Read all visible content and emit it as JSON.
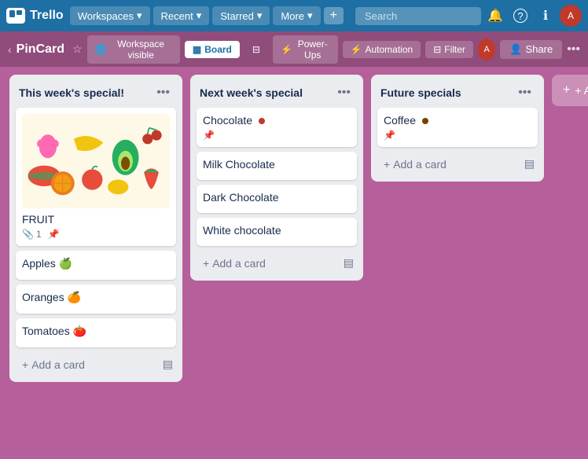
{
  "topNav": {
    "logoText": "Trello",
    "workspacesLabel": "Workspaces",
    "recentLabel": "Recent",
    "starredLabel": "Starred",
    "moreLabel": "More",
    "searchPlaceholder": "Search",
    "icons": {
      "bell": "🔔",
      "question": "?",
      "grid": "⊞",
      "create": "+"
    }
  },
  "boardHeader": {
    "backArrow": "‹",
    "title": "PinCard",
    "starIcon": "☆",
    "workspaceLabel": "Workspace visible",
    "boardLabel": "Board",
    "powerUpsLabel": "Power-Ups",
    "automationLabel": "Automation",
    "filterLabel": "Filter",
    "shareLabel": "Share",
    "moreIcon": "•••"
  },
  "lists": [
    {
      "id": "list1",
      "title": "This week's special!",
      "cards": [
        {
          "id": "card1",
          "hasImage": true,
          "title": "FRUIT",
          "attachCount": "1",
          "pinned": true
        },
        {
          "id": "card2",
          "hasImage": false,
          "title": "Apples 🍏",
          "pinned": false
        },
        {
          "id": "card3",
          "hasImage": false,
          "title": "Oranges 🍊",
          "pinned": false
        },
        {
          "id": "card4",
          "hasImage": false,
          "title": "Tomatoes 🍅",
          "pinned": false
        }
      ],
      "addCardLabel": "Add a card"
    },
    {
      "id": "list2",
      "title": "Next week's special",
      "cards": [
        {
          "id": "card5",
          "hasImage": false,
          "title": "Chocolate",
          "hasDot": true,
          "dotColor": "#c0392b",
          "pinned": true
        },
        {
          "id": "card6",
          "hasImage": false,
          "title": "Milk Chocolate",
          "pinned": false
        },
        {
          "id": "card7",
          "hasImage": false,
          "title": "Dark Chocolate",
          "pinned": false
        },
        {
          "id": "card8",
          "hasImage": false,
          "title": "White chocolate",
          "pinned": false
        }
      ],
      "addCardLabel": "Add a card"
    },
    {
      "id": "list3",
      "title": "Future specials",
      "cards": [
        {
          "id": "card9",
          "hasImage": false,
          "title": "Coffee",
          "hasDot": true,
          "dotColor": "#7b3f00",
          "pinned": true
        }
      ],
      "addCardLabel": "Add a card"
    }
  ],
  "addAnotherLabel": "+ Add another"
}
